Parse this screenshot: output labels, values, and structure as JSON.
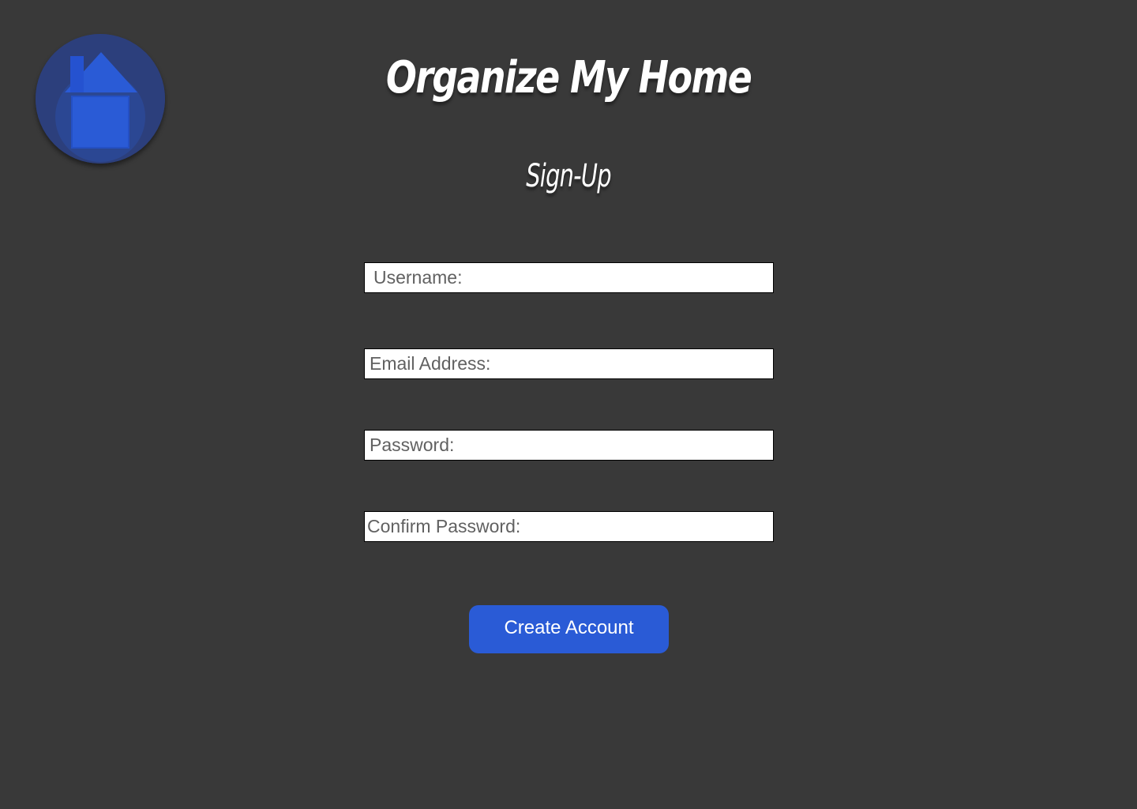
{
  "header": {
    "app_title": "Organize My Home",
    "logo_icon": "house-icon"
  },
  "page_title": "Sign-Up",
  "form": {
    "username": {
      "placeholder": "Username:",
      "value": ""
    },
    "email": {
      "placeholder": "Email Address:",
      "value": ""
    },
    "password": {
      "placeholder": "Password:",
      "value": ""
    },
    "confirm_password": {
      "placeholder": "Confirm Password:",
      "value": ""
    },
    "submit_label": "Create Account"
  },
  "colors": {
    "background": "#393939",
    "accent": "#2a5bd6",
    "logo_circle": "#2c3f7c",
    "text": "#ffffff"
  }
}
